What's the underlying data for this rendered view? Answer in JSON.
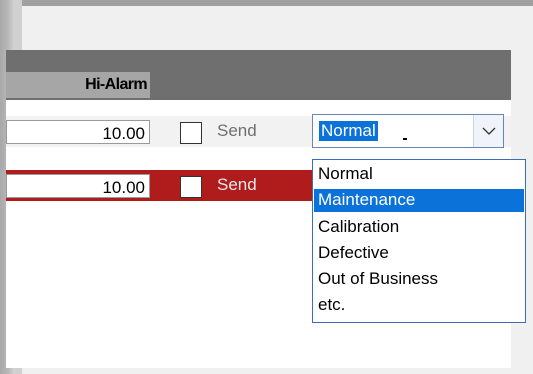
{
  "grid": {
    "columns": [
      {
        "header": "Hi-Alarm"
      }
    ],
    "rows": [
      {
        "hi_alarm": "10.00",
        "send_label": "Send",
        "send_checked": false,
        "status_color": "#f2f2f2"
      },
      {
        "hi_alarm": "10.00",
        "send_label": "Send",
        "send_checked": false,
        "status_color": "#b01c1c"
      }
    ]
  },
  "status_combo": {
    "selected": "Normal",
    "icon": "chevron-down-icon",
    "options": [
      "Normal",
      "Maintenance",
      "Calibration",
      "Defective",
      "Out of Business",
      "etc."
    ],
    "highlighted_index": 1
  },
  "colors": {
    "header_bg": "#6f6f6f",
    "alarm_row": "#b01c1c",
    "selection": "#0a72d8"
  }
}
